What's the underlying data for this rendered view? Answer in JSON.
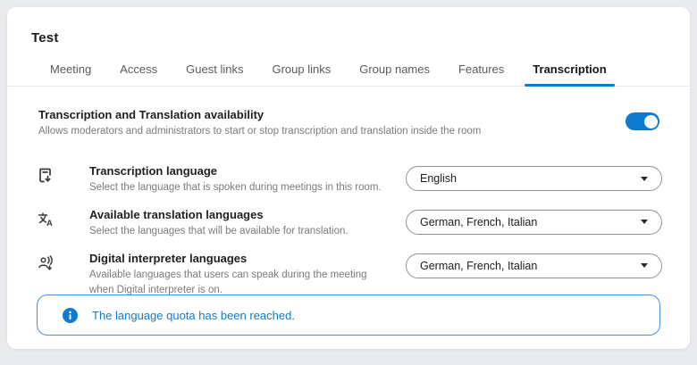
{
  "window": {
    "title": "Test"
  },
  "colors": {
    "accent": "#0F7BD0",
    "alert_border": "#4A90D8",
    "page_background": "#E9EBEE",
    "card_background": "#FFFFFF",
    "secondary_text": "#7B7B7B"
  },
  "tabs": {
    "items": [
      {
        "label": "Meeting",
        "active": false
      },
      {
        "label": "Access",
        "active": false
      },
      {
        "label": "Guest links",
        "active": false
      },
      {
        "label": "Group links",
        "active": false
      },
      {
        "label": "Group names",
        "active": false
      },
      {
        "label": "Features",
        "active": false
      },
      {
        "label": "Transcription",
        "active": true
      }
    ]
  },
  "availability": {
    "title": "Transcription and Translation availability",
    "description": "Allows moderators and administrators to start or stop transcription and translation inside the room",
    "toggle_state": "on"
  },
  "settings": {
    "rows": [
      {
        "icon": "transcription-document-icon",
        "title": "Transcription language",
        "description": "Select the language that is spoken during meetings in this room.",
        "value": "English"
      },
      {
        "icon": "translate-icon",
        "title": "Available translation languages",
        "description": "Select the languages that will be available for translation.",
        "value": "German, French, Italian"
      },
      {
        "icon": "interpreter-person-voice-icon",
        "title": "Digital interpreter languages",
        "description": "Available languages that users can speak during the meeting when Digital interpreter is on.",
        "value": "German, French, Italian"
      }
    ]
  },
  "alert": {
    "icon": "info-icon",
    "message": "The language quota has been reached."
  }
}
